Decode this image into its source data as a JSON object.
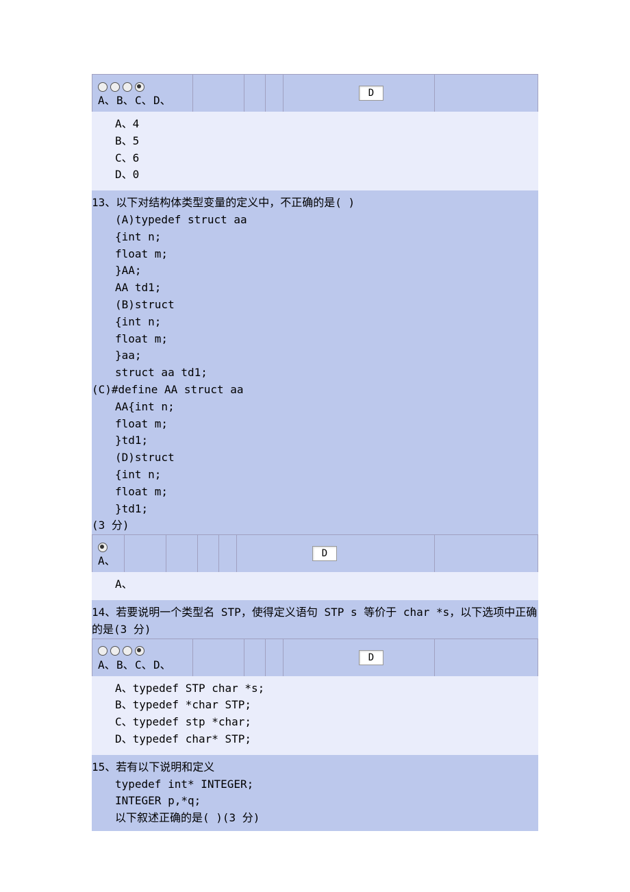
{
  "q12": {
    "radios": [
      "A、",
      "B、",
      "C、",
      "D、"
    ],
    "selected_index": 3,
    "answer": "D",
    "options": "A、4\nB、5\nC、6\nD、0"
  },
  "q13": {
    "number": "13、",
    "stem": "以下对结构体类型变量的定义中，不正确的是( )",
    "body_lines": [
      "(A)typedef struct aa",
      "{int n;",
      "float m;",
      "}AA;",
      "AA td1;",
      "(B)struct",
      "{int n;",
      "float m;",
      "}aa;",
      "struct aa td1;"
    ],
    "flush_line": "(C)#define AA struct aa",
    "body_lines2": [
      "AA{int n;",
      "float m;",
      "}td1;",
      "(D)struct",
      "{int n;",
      "float m;",
      "}td1;"
    ],
    "points": "(3 分)",
    "radios": [
      "A、"
    ],
    "selected_index": 0,
    "answer": "D",
    "options": "A、"
  },
  "q14": {
    "number": "14、",
    "stem": "若要说明一个类型名 STP，使得定义语句 STP s 等价于 char *s，以下选项中正确的是(3 分)",
    "radios": [
      "A、",
      "B、",
      "C、",
      "D、"
    ],
    "selected_index": 3,
    "answer": "D",
    "options": "A、typedef STP char *s;\nB、typedef *char STP;\nC、typedef stp *char;\nD、typedef char* STP;"
  },
  "q15": {
    "number": "15、",
    "stem": "若有以下说明和定义",
    "body_lines": [
      "typedef int* INTEGER;",
      "INTEGER p,*q;",
      "以下叙述正确的是( )(3 分)"
    ]
  }
}
